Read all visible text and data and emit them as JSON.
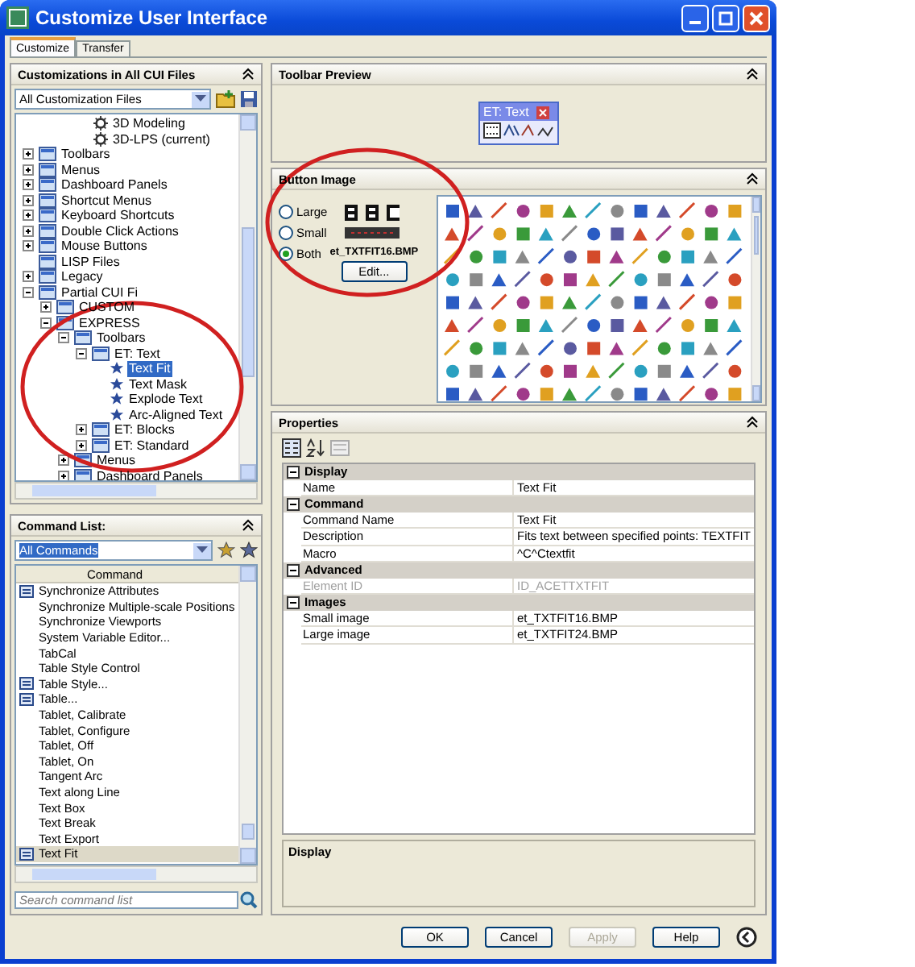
{
  "window": {
    "title": "Customize User Interface"
  },
  "tabs": [
    {
      "label": "Customize",
      "selected": true
    },
    {
      "label": "Transfer",
      "selected": false
    }
  ],
  "customizations": {
    "title": "Customizations in All CUI Files",
    "dropdown": "All Customization Files",
    "tree_partial": [
      {
        "label": "3D Modeling",
        "selected": false
      },
      {
        "label": "3D-LPS (current)",
        "selected": false
      }
    ],
    "tree": [
      {
        "label": "Toolbars",
        "expanded": false,
        "selected": false
      },
      {
        "label": "Menus",
        "expanded": false,
        "selected": false
      },
      {
        "label": "Dashboard Panels",
        "expanded": false,
        "selected": false
      },
      {
        "label": "Shortcut Menus",
        "expanded": false,
        "selected": false
      },
      {
        "label": "Keyboard Shortcuts",
        "expanded": false,
        "selected": false
      },
      {
        "label": "Double Click Actions",
        "expanded": false,
        "selected": false
      },
      {
        "label": "Mouse Buttons",
        "expanded": false,
        "selected": false
      },
      {
        "label": "LISP Files",
        "selected": false
      },
      {
        "label": "Legacy",
        "expanded": false,
        "selected": false
      },
      {
        "label": "Partial CUI Fi",
        "expanded": true,
        "selected": false,
        "children": [
          {
            "label": "CUSTOM",
            "expanded": false,
            "selected": false
          },
          {
            "label": "EXPRESS",
            "expanded": true,
            "selected": false,
            "children": [
              {
                "label": "Toolbars",
                "expanded": true,
                "selected": false,
                "children": [
                  {
                    "label": "ET: Text",
                    "expanded": true,
                    "selected": false,
                    "children": [
                      {
                        "label": "Text Fit",
                        "kind": "command",
                        "selected": true
                      },
                      {
                        "label": "Text Mask",
                        "kind": "command",
                        "selected": false
                      },
                      {
                        "label": "Explode Text",
                        "kind": "command",
                        "selected": false
                      },
                      {
                        "label": "Arc-Aligned Text",
                        "kind": "command",
                        "selected": false
                      }
                    ]
                  },
                  {
                    "label": "ET: Blocks",
                    "expanded": false,
                    "selected": false
                  },
                  {
                    "label": "ET: Standard",
                    "expanded": false,
                    "selected": false
                  }
                ]
              },
              {
                "label": "Menus",
                "expanded": false,
                "selected": false
              },
              {
                "label": "Dashboard Panels",
                "expanded": false,
                "selected": false
              }
            ]
          }
        ]
      }
    ]
  },
  "command_list": {
    "title": "Command List:",
    "dropdown": "All Commands",
    "column": "Command",
    "rows": [
      {
        "label": "Synchronize Attributes",
        "icon": true,
        "selected": false
      },
      {
        "label": "Synchronize Multiple-scale Positions",
        "icon": false,
        "selected": false
      },
      {
        "label": "Synchronize Viewports",
        "icon": false,
        "selected": false
      },
      {
        "label": "System Variable Editor...",
        "icon": false,
        "selected": false
      },
      {
        "label": "TabCal",
        "icon": false,
        "selected": false
      },
      {
        "label": "Table Style Control",
        "icon": false,
        "selected": false
      },
      {
        "label": "Table Style...",
        "icon": true,
        "selected": false
      },
      {
        "label": "Table...",
        "icon": true,
        "selected": false
      },
      {
        "label": "Tablet, Calibrate",
        "icon": false,
        "selected": false
      },
      {
        "label": "Tablet, Configure",
        "icon": false,
        "selected": false
      },
      {
        "label": "Tablet, Off",
        "icon": false,
        "selected": false
      },
      {
        "label": "Tablet, On",
        "icon": false,
        "selected": false
      },
      {
        "label": "Tangent Arc",
        "icon": false,
        "selected": false
      },
      {
        "label": "Text along Line",
        "icon": false,
        "selected": false
      },
      {
        "label": "Text Box",
        "icon": false,
        "selected": false
      },
      {
        "label": "Text Break",
        "icon": false,
        "selected": false
      },
      {
        "label": "Text Export",
        "icon": false,
        "selected": false
      },
      {
        "label": "Text Fit",
        "icon": true,
        "selected": true
      }
    ],
    "search": {
      "placeholder": "Search command list"
    }
  },
  "toolbar_preview": {
    "title": "Toolbar Preview",
    "toolbar_title": "ET: Text"
  },
  "button_image": {
    "title": "Button Image",
    "sizes": [
      {
        "label": "Large",
        "selected": false
      },
      {
        "label": "Small",
        "selected": false
      },
      {
        "label": "Both",
        "selected": true
      }
    ],
    "filename": "et_TXTFIT16.BMP",
    "edit_button": "Edit..."
  },
  "properties": {
    "title": "Properties",
    "groups": [
      {
        "name": "Display",
        "expanded": true,
        "rows": [
          {
            "name": "Name",
            "value": "Text Fit",
            "disabled": false
          }
        ]
      },
      {
        "name": "Command",
        "expanded": true,
        "rows": [
          {
            "name": "Command Name",
            "value": "Text Fit",
            "disabled": false
          },
          {
            "name": "Description",
            "value": "Fits text between specified points: TEXTFIT",
            "disabled": false
          },
          {
            "name": "Macro",
            "value": "^C^Ctextfit",
            "disabled": false
          }
        ]
      },
      {
        "name": "Advanced",
        "expanded": true,
        "rows": [
          {
            "name": "Element ID",
            "value": "ID_ACETTXTFIT",
            "disabled": true
          }
        ]
      },
      {
        "name": "Images",
        "expanded": true,
        "rows": [
          {
            "name": "Small image",
            "value": "et_TXTFIT16.BMP",
            "disabled": false
          },
          {
            "name": "Large image",
            "value": "et_TXTFIT24.BMP",
            "disabled": false
          }
        ]
      }
    ],
    "display_title": "Display"
  },
  "buttons": [
    {
      "label": "OK",
      "disabled": false
    },
    {
      "label": "Cancel",
      "disabled": false
    },
    {
      "label": "Apply",
      "disabled": true
    },
    {
      "label": "Help",
      "disabled": false
    }
  ]
}
